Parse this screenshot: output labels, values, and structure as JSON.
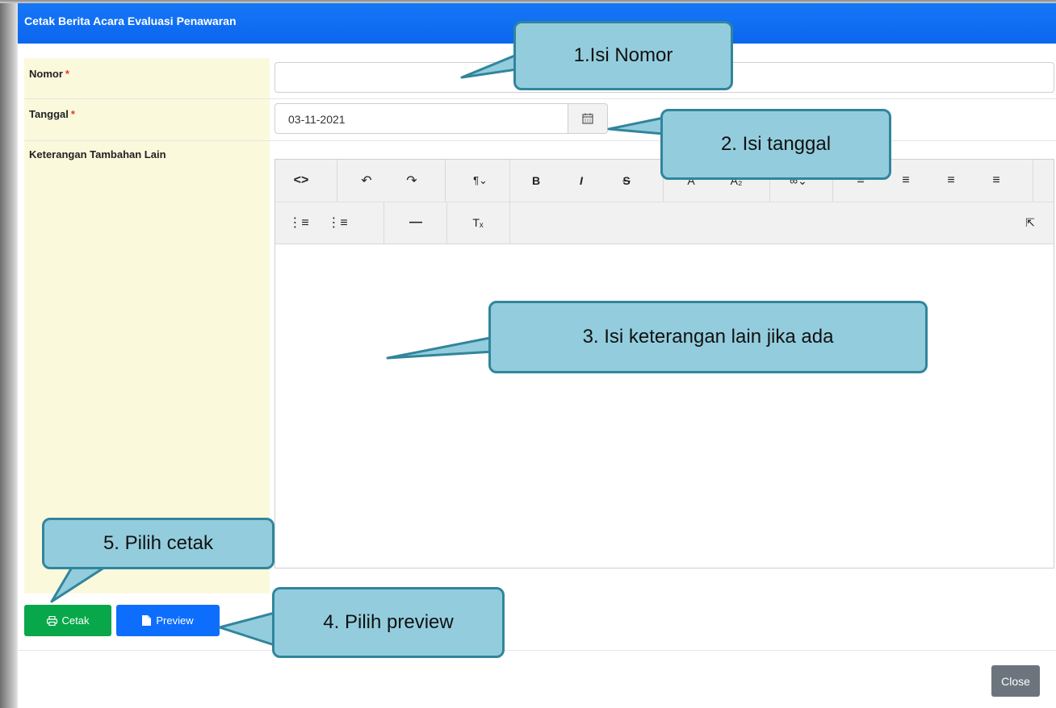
{
  "modal": {
    "title": "Cetak Berita Acara Evaluasi Penawaran",
    "close_label": "Close"
  },
  "form": {
    "nomor": {
      "label": "Nomor",
      "required_mark": "*",
      "value": ""
    },
    "tanggal": {
      "label": "Tanggal",
      "required_mark": "*",
      "value": "03-11-2021"
    },
    "keterangan": {
      "label": "Keterangan Tambahan Lain",
      "content": ""
    }
  },
  "toolbar": {
    "row1": [
      "code-view",
      "undo",
      "redo",
      "paragraph-style",
      "bold",
      "italic",
      "strikethrough",
      "superscript",
      "subscript",
      "link",
      "align-left",
      "align-center",
      "align-right",
      "align-justify"
    ],
    "row2": [
      "ordered-list",
      "unordered-list",
      "horizontal-rule",
      "clear-format",
      "fullscreen"
    ]
  },
  "buttons": {
    "cetak": "Cetak",
    "preview": "Preview"
  },
  "callouts": {
    "c1": "1.Isi Nomor",
    "c2": "2. Isi tanggal",
    "c3": "3. Isi keterangan lain jika ada",
    "c4": "4. Pilih preview",
    "c5": "5. Pilih cetak"
  },
  "colors": {
    "header": "#0d6efd",
    "cetak": "#08a84a",
    "preview": "#0d6efd",
    "label_bg": "#fbf9dc",
    "callout_fill": "#93cddd",
    "callout_border": "#31859c"
  }
}
